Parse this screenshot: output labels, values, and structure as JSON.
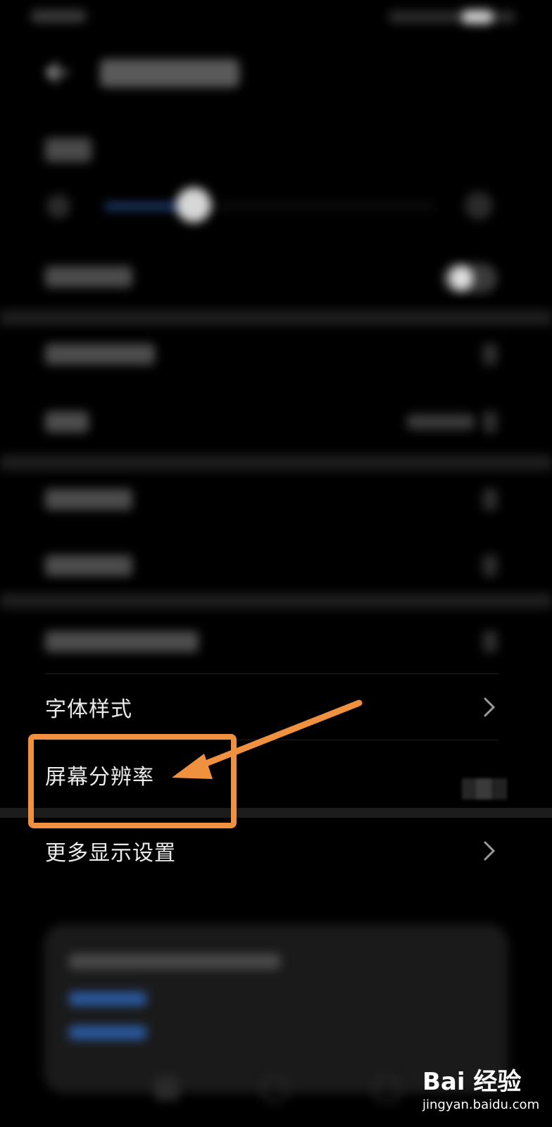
{
  "rows": [
    {
      "label": "字体样式"
    },
    {
      "label": "屏幕分辨率"
    },
    {
      "label": "更多显示设置"
    }
  ],
  "colors": {
    "background": "#000000",
    "annotation": "#f0913f"
  },
  "watermark": {
    "logo": "Bai 经验",
    "url": "jingyan.baidu.com"
  }
}
